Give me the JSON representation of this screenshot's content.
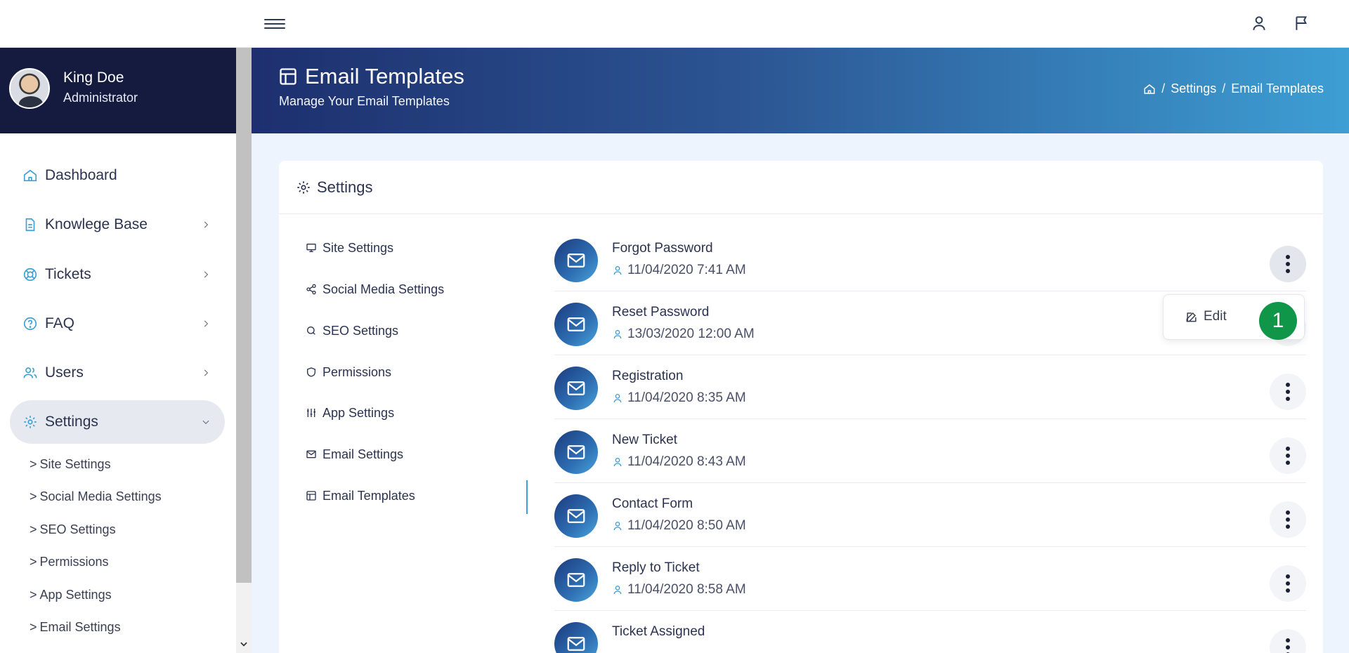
{
  "topbar": {
    "menu_icon": "hamburger-icon",
    "user_icon": "user-icon",
    "flag_icon": "flag-icon"
  },
  "profile": {
    "name": "King Doe",
    "role": "Administrator"
  },
  "nav": {
    "items": [
      {
        "label": "Dashboard",
        "icon": "home-icon"
      },
      {
        "label": "Knowlege Base",
        "icon": "document-icon"
      },
      {
        "label": "Tickets",
        "icon": "lifebuoy-icon"
      },
      {
        "label": "FAQ",
        "icon": "help-icon"
      },
      {
        "label": "Users",
        "icon": "users-icon"
      },
      {
        "label": "Settings",
        "icon": "gear-icon"
      }
    ],
    "sub_items": [
      "Site Settings",
      "Social Media Settings",
      "SEO Settings",
      "Permissions",
      "App Settings",
      "Email Settings"
    ]
  },
  "header": {
    "title": "Email Templates",
    "subtitle": "Manage Your Email Templates",
    "breadcrumb": {
      "settings": "Settings",
      "current": "Email Templates",
      "separator": "/"
    }
  },
  "card": {
    "title": "Settings",
    "menu": [
      "Site Settings",
      "Social Media Settings",
      "SEO Settings",
      "Permissions",
      "App Settings",
      "Email Settings",
      "Email Templates"
    ],
    "templates": [
      {
        "name": "Forgot Password",
        "date": "11/04/2020 7:41 AM"
      },
      {
        "name": "Reset Password",
        "date": "13/03/2020 12:00 AM"
      },
      {
        "name": "Registration",
        "date": "11/04/2020 8:35 AM"
      },
      {
        "name": "New Ticket",
        "date": "11/04/2020 8:43 AM"
      },
      {
        "name": "Contact Form",
        "date": "11/04/2020 8:50 AM"
      },
      {
        "name": "Reply to Ticket",
        "date": "11/04/2020 8:58 AM"
      },
      {
        "name": "Ticket Assigned",
        "date": ""
      }
    ],
    "dropdown": {
      "edit_label": "Edit"
    },
    "badge": "1"
  },
  "colors": {
    "brand_dark": "#141b3f",
    "accent": "#3d9fd4",
    "badge": "#109648"
  }
}
